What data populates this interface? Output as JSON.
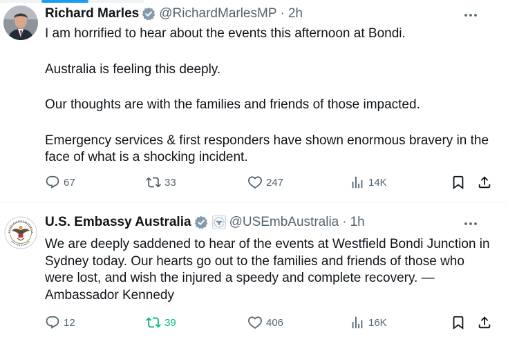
{
  "tweets": [
    {
      "author_name": "Richard Marles",
      "handle": "@RichardMarlesMP",
      "separator": "·",
      "time": "2h",
      "paragraphs": [
        "I am horrified to hear about the events this afternoon at Bondi.",
        "Australia is feeling this deeply.",
        "Our thoughts are with the families and friends of those impacted.",
        "Emergency services & first responders have shown enormous bravery in the face of what is a shocking incident."
      ],
      "replies": "67",
      "reposts": "33",
      "likes": "247",
      "views": "14K",
      "reposted_by_viewer": false
    },
    {
      "author_name": "U.S. Embassy Australia",
      "handle": "@USEmbAustralia",
      "separator": "·",
      "time": "1h",
      "paragraphs": [
        "We are deeply saddened to hear of the events at Westfield Bondi Junction in Sydney today. Our hearts go out to the families and friends of those who were lost, and wish the injured a speedy and complete recovery. — Ambassador Kennedy"
      ],
      "replies": "12",
      "reposts": "39",
      "likes": "406",
      "views": "16K",
      "reposted_by_viewer": true
    }
  ],
  "icons": {
    "verified": "verified-badge-icon",
    "affiliation": "government-seal-icon",
    "more": "more-options-icon",
    "reply": "reply-icon",
    "repost": "repost-icon",
    "like": "heart-icon",
    "views": "analytics-icon",
    "bookmark": "bookmark-icon",
    "share": "share-icon"
  },
  "colors": {
    "accent": "#1d9bf0",
    "text": "#0f1419",
    "muted": "#536471",
    "repost_active": "#00ba7c",
    "divider": "#eff3f4"
  }
}
